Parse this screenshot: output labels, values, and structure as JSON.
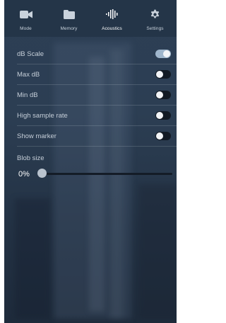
{
  "tabs": [
    {
      "label": "Mode",
      "icon": "video-camera-icon",
      "active": false
    },
    {
      "label": "Memory",
      "icon": "folder-icon",
      "active": false
    },
    {
      "label": "Acoustics",
      "icon": "waveform-icon",
      "active": true
    },
    {
      "label": "Settings",
      "icon": "gear-icon",
      "active": false
    }
  ],
  "settings": {
    "db_scale": {
      "label": "dB Scale",
      "on": true
    },
    "max_db": {
      "label": "Max dB",
      "on": false
    },
    "min_db": {
      "label": "Min dB",
      "on": false
    },
    "high_sample_rate": {
      "label": "High sample rate",
      "on": false
    },
    "show_marker": {
      "label": "Show marker",
      "on": false
    }
  },
  "blob_size": {
    "label": "Blob size",
    "value_text": "0%",
    "value": 0
  },
  "colors": {
    "active_tab": "#ffffff",
    "toggle_on": "#9fb6cc",
    "toggle_off": "#121a24"
  }
}
